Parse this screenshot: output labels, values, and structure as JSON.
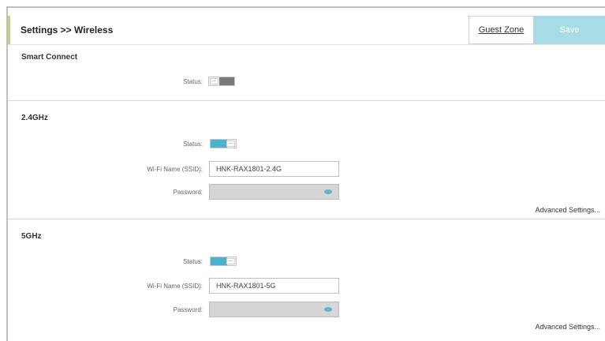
{
  "header": {
    "title": "Settings >> Wireless",
    "guest_zone_label": "Guest Zone",
    "save_label": "Save"
  },
  "smart_connect": {
    "title": "Smart Connect",
    "status_label": "Status:",
    "status": "off"
  },
  "band_24": {
    "title": "2.4GHz",
    "status_label": "Status:",
    "status": "on",
    "ssid_label": "Wi-Fi Name (SSID):",
    "ssid_value": "HNK-RAX1801-2.4G",
    "password_label": "Password:",
    "password_icon": "eye-icon",
    "advanced_label": "Advanced Settings..."
  },
  "band_5": {
    "title": "5GHz",
    "status_label": "Status:",
    "status": "on",
    "ssid_label": "Wi-Fi Name (SSID):",
    "ssid_value": "HNK-RAX1801-5G",
    "password_label": "Password:",
    "password_icon": "eye-icon",
    "advanced_label": "Advanced Settings..."
  },
  "colors": {
    "accent": "#49b4cf",
    "save_button": "#a7dbe6",
    "header_accent": "#b8d67a"
  }
}
